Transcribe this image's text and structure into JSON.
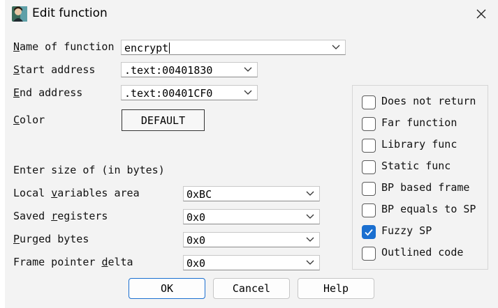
{
  "window": {
    "title": "Edit function",
    "icon": "app-portrait-icon",
    "close_icon": "close-icon"
  },
  "fields": {
    "name_of_function": {
      "label": "Name of function",
      "mnemonic": "N",
      "value": "encrypt"
    },
    "start_address": {
      "label": "Start address",
      "mnemonic": "S",
      "value": ".text:00401830"
    },
    "end_address": {
      "label": "End address",
      "mnemonic": "E",
      "value": ".text:00401CF0"
    },
    "color": {
      "label": "Color",
      "mnemonic": "C",
      "button_label": "DEFAULT"
    }
  },
  "sizes": {
    "heading": "Enter size of (in bytes)",
    "local_variables": {
      "label": "Local variables area",
      "mnemonic": "v",
      "value": "0xBC"
    },
    "saved_registers": {
      "label": "Saved registers",
      "mnemonic": "r",
      "value": "0x0"
    },
    "purged_bytes": {
      "label": "Purged bytes",
      "mnemonic": "P",
      "value": "0x0"
    },
    "frame_pointer_delta": {
      "label": "Frame pointer delta",
      "mnemonic": "d",
      "value": "0x0"
    }
  },
  "flags": [
    {
      "label": "Does not return",
      "checked": false
    },
    {
      "label": "Far function",
      "checked": false
    },
    {
      "label": "Library func",
      "checked": false
    },
    {
      "label": "Static func",
      "checked": false
    },
    {
      "label": "BP based frame",
      "checked": false
    },
    {
      "label": "BP equals to SP",
      "checked": false
    },
    {
      "label": "Fuzzy SP",
      "checked": true
    },
    {
      "label": "Outlined code",
      "checked": false
    }
  ],
  "buttons": {
    "ok": "OK",
    "cancel": "Cancel",
    "help": "Help"
  },
  "colors": {
    "accent": "#1a6fd0",
    "dialog_bg": "#f3f3f3"
  }
}
